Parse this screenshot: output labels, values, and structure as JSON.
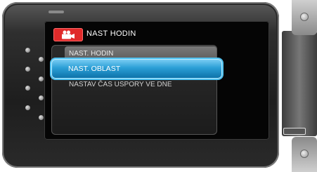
{
  "menu": {
    "title": "NAST HODIN",
    "header_icon": "video-camera-icon",
    "items": [
      {
        "label": "NAST. HODIN",
        "state": "normal"
      },
      {
        "label": "NAST. OBLAST",
        "state": "selected"
      },
      {
        "label": "NASTAV ČAS USPORY VE DNE",
        "state": "normal"
      }
    ]
  },
  "colors": {
    "accent_selected": "#2b9fd6",
    "header_icon_bg": "#e02a2a"
  }
}
